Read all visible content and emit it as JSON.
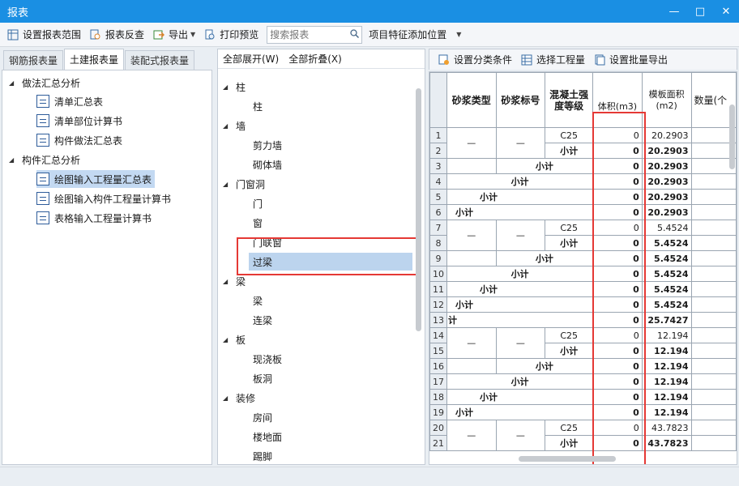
{
  "window": {
    "title": "报表",
    "controls": [
      "—",
      "□",
      "✕"
    ]
  },
  "toolbar": {
    "set_range": "设置报表范围",
    "report_check": "报表反查",
    "export": "导出",
    "print_preview": "打印预览",
    "search_placeholder": "搜索报表",
    "feature_position": "项目特征添加位置"
  },
  "left_tabs": [
    "钢筋报表量",
    "土建报表量",
    "装配式报表量"
  ],
  "report_tree": {
    "group1": "做法汇总分析",
    "group1_items": [
      "清单汇总表",
      "清单部位计算书",
      "构件做法汇总表"
    ],
    "group2": "构件汇总分析",
    "group2_items": [
      "绘图输入工程量汇总表",
      "绘图输入构件工程量计算书",
      "表格输入工程量计算书"
    ]
  },
  "middle": {
    "expand_all": "全部展开(W)",
    "collapse_all": "全部折叠(X)",
    "tree": {
      "col": "柱",
      "col_items": [
        "柱"
      ],
      "wall": "墙",
      "wall_items": [
        "剪力墙",
        "砌体墙"
      ],
      "opening": "门窗洞",
      "opening_items": [
        "门",
        "窗",
        "门联窗",
        "过梁"
      ],
      "beam": "梁",
      "beam_items": [
        "梁",
        "连梁"
      ],
      "slab": "板",
      "slab_items": [
        "现浇板",
        "板洞"
      ],
      "finish": "装修",
      "finish_items": [
        "房间",
        "楼地面",
        "踢脚"
      ]
    }
  },
  "right_toolbar": {
    "set_category": "设置分类条件",
    "select_quantity": "选择工程量",
    "batch_export": "设置批量导出"
  },
  "grid": {
    "headers": [
      "砂浆类型",
      "砂浆标号",
      "混凝土强度等级",
      "体积(m3)",
      "模板面积(m2)",
      "数量(个"
    ],
    "subtotal": "小计",
    "dash": "—",
    "rows": [
      {
        "n": "1",
        "grade": "C25",
        "vol": "0",
        "area": "20.2903"
      },
      {
        "n": "2",
        "label": "小计",
        "vol": "0",
        "area": "20.2903"
      },
      {
        "n": "3",
        "label": "小计",
        "vol": "0",
        "area": "20.2903"
      },
      {
        "n": "4",
        "label": "小计",
        "vol": "0",
        "area": "20.2903"
      },
      {
        "n": "5",
        "label": "小计",
        "vol": "0",
        "area": "20.2903"
      },
      {
        "n": "6",
        "label": "小计",
        "vol": "0",
        "area": "20.2903"
      },
      {
        "n": "7",
        "grade": "C25",
        "vol": "0",
        "area": "5.4524"
      },
      {
        "n": "8",
        "label": "小计",
        "vol": "0",
        "area": "5.4524"
      },
      {
        "n": "9",
        "label": "小计",
        "vol": "0",
        "area": "5.4524"
      },
      {
        "n": "10",
        "label": "小计",
        "vol": "0",
        "area": "5.4524"
      },
      {
        "n": "11",
        "label": "小计",
        "vol": "0",
        "area": "5.4524"
      },
      {
        "n": "12",
        "label": "小计",
        "vol": "0",
        "area": "5.4524"
      },
      {
        "n": "13",
        "label": "计",
        "vol": "0",
        "area": "25.7427"
      },
      {
        "n": "14",
        "grade": "C25",
        "vol": "0",
        "area": "12.194"
      },
      {
        "n": "15",
        "label": "小计",
        "vol": "0",
        "area": "12.194"
      },
      {
        "n": "16",
        "label": "小计",
        "vol": "0",
        "area": "12.194"
      },
      {
        "n": "17",
        "label": "小计",
        "vol": "0",
        "area": "12.194"
      },
      {
        "n": "18",
        "label": "小计",
        "vol": "0",
        "area": "12.194"
      },
      {
        "n": "19",
        "label": "小计",
        "vol": "0",
        "area": "12.194"
      },
      {
        "n": "20",
        "grade": "C25",
        "vol": "0",
        "area": "43.7823"
      },
      {
        "n": "21",
        "label": "小计",
        "vol": "0",
        "area": "43.7823"
      }
    ]
  }
}
